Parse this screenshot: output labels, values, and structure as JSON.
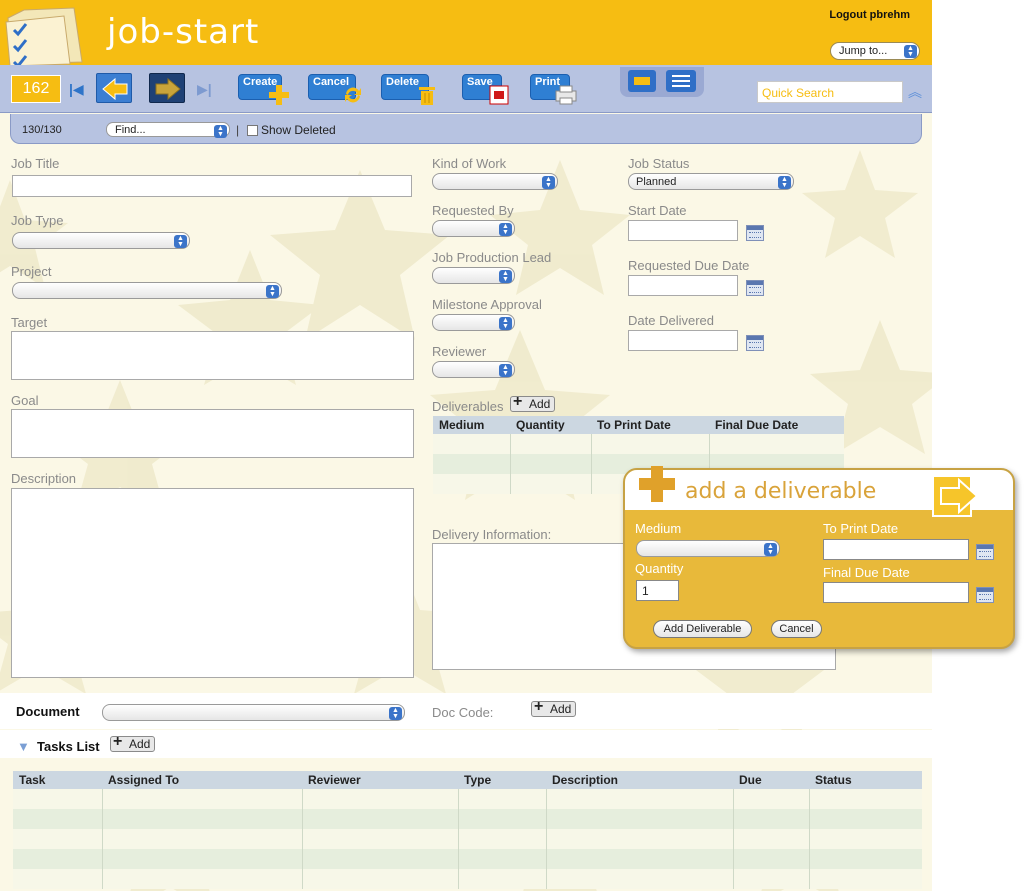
{
  "header": {
    "app_title": "job-start",
    "logout_label": "Logout pbrehm",
    "jump_label": "Jump to..."
  },
  "toolbar": {
    "record_number": "162",
    "create_label": "Create",
    "cancel_label": "Cancel",
    "delete_label": "Delete",
    "save_label": "Save",
    "print_label": "Print",
    "quick_search_placeholder": "Quick Search"
  },
  "findbar": {
    "count": "130/130",
    "find_label": "Find...",
    "show_deleted_label": "Show Deleted"
  },
  "form": {
    "job_title_label": "Job Title",
    "job_type_label": "Job Type",
    "project_label": "Project",
    "target_label": "Target",
    "goal_label": "Goal",
    "description_label": "Description",
    "kind_of_work_label": "Kind of Work",
    "requested_by_label": "Requested By",
    "job_production_lead_label": "Job Production Lead",
    "milestone_approval_label": "Milestone Approval",
    "reviewer_label": "Reviewer",
    "job_status_label": "Job Status",
    "job_status_value": "Planned",
    "start_date_label": "Start Date",
    "requested_due_date_label": "Requested Due Date",
    "date_delivered_label": "Date Delivered",
    "deliverables_label": "Deliverables",
    "delivery_information_label": "Delivery Information:",
    "add_label": "Add"
  },
  "deliverables_table": {
    "columns": [
      "Medium",
      "Quantity",
      "To Print Date",
      "Final Due Date"
    ]
  },
  "document": {
    "label": "Document",
    "doc_code_label": "Doc Code:",
    "add_label": "Add"
  },
  "tasks": {
    "label": "Tasks List",
    "add_label": "Add",
    "columns": [
      "Task",
      "Assigned To",
      "Reviewer",
      "Type",
      "Description",
      "Due",
      "Status"
    ]
  },
  "popup": {
    "title": "add a deliverable",
    "medium_label": "Medium",
    "quantity_label": "Quantity",
    "quantity_value": "1",
    "to_print_date_label": "To Print Date",
    "final_due_date_label": "Final Due Date",
    "add_button_label": "Add Deliverable",
    "cancel_button_label": "Cancel"
  },
  "colors": {
    "header_yellow": "#f6bd12",
    "toolbar_blue": "#b7c3e1",
    "button_blue": "#2f7fd3",
    "popup_gold": "#e8b93a"
  }
}
